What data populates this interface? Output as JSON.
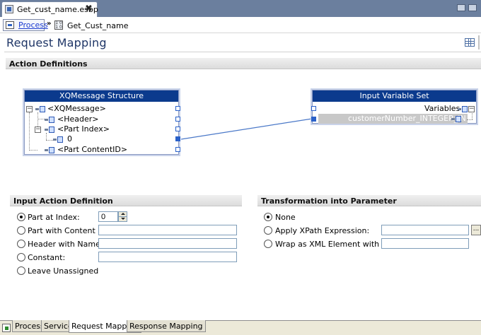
{
  "editor": {
    "tab_title": "Get_cust_name.esbp",
    "close_glyph": "✖"
  },
  "breadcrumb": {
    "root": "Process",
    "separator": "»",
    "current": "Get_Cust_name"
  },
  "page": {
    "title": "Request Mapping"
  },
  "sections": {
    "action_definitions": "Action Definitions",
    "input_action_definition": "Input Action Definition",
    "transformation": "Transformation into Parameter"
  },
  "xq_structure": {
    "title": "XQMessage Structure",
    "nodes": [
      "<XQMessage>",
      "<Header>",
      "<Part Index>",
      "0",
      "<Part ContentID>"
    ]
  },
  "input_variables": {
    "title": "Input Variable Set",
    "nodes": [
      "Variables",
      "customerNumber_INTEGER_IN"
    ]
  },
  "input_action": {
    "part_at_index": {
      "label": "Part at Index:",
      "value": "0",
      "selected": true
    },
    "part_with_content_id": {
      "label": "Part with Content ID:",
      "value": ""
    },
    "header_with_name": {
      "label": "Header with Name:",
      "value": ""
    },
    "constant": {
      "label": "Constant:",
      "value": ""
    },
    "leave_unassigned": {
      "label": "Leave Unassigned"
    }
  },
  "transformation": {
    "none": {
      "label": "None",
      "selected": true
    },
    "apply_xpath": {
      "label": "Apply XPath Expression:",
      "value": "",
      "browse": "..."
    },
    "wrap_xml": {
      "label": "Wrap as XML Element with Name:",
      "value": ""
    }
  },
  "bottom_tabs": [
    "Process",
    "Service",
    "Request Mapping",
    "Response Mapping"
  ],
  "colors": {
    "box_title": "#0b3a8d",
    "link": "#1b3bd1",
    "connector": "#4a78c8",
    "heading": "#1e3566"
  }
}
